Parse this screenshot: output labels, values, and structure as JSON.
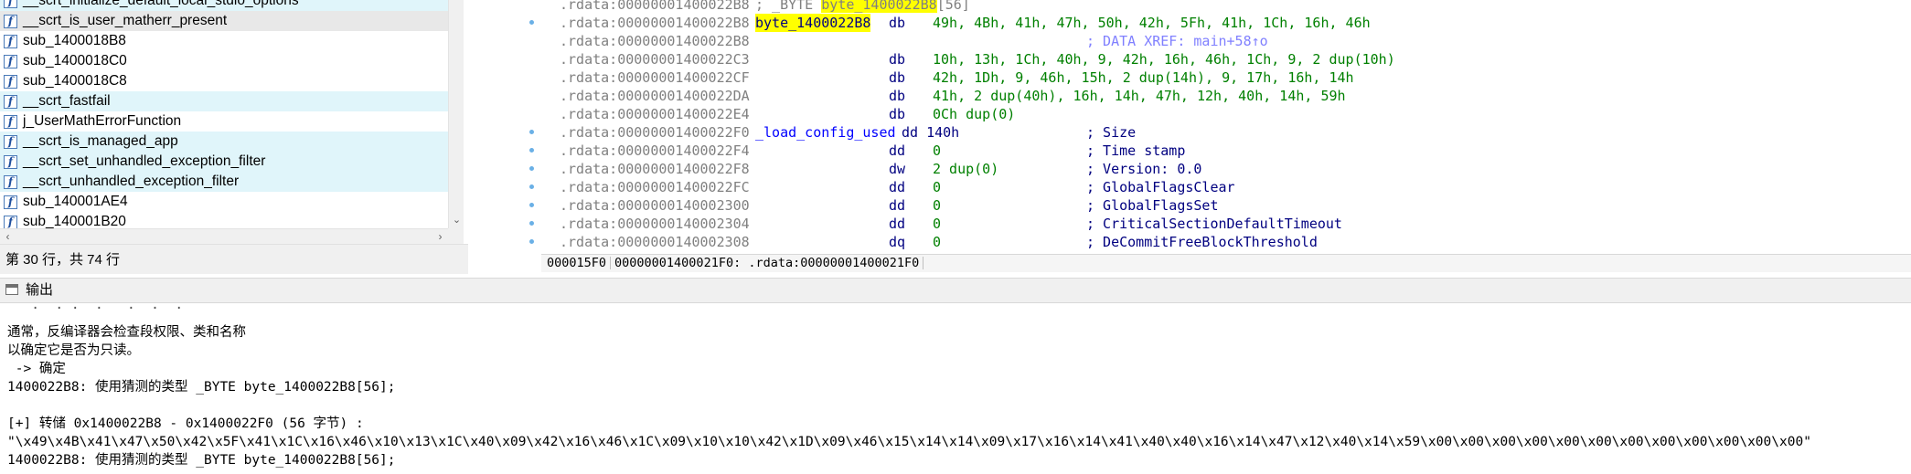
{
  "functions": {
    "items": [
      {
        "name": "__scrt_initialize_default_local_stdio_options",
        "style": "hl"
      },
      {
        "name": "__scrt_is_user_matherr_present",
        "style": "sel"
      },
      {
        "name": "sub_1400018B8",
        "style": ""
      },
      {
        "name": "sub_1400018C0",
        "style": ""
      },
      {
        "name": "sub_1400018C8",
        "style": ""
      },
      {
        "name": "__scrt_fastfail",
        "style": "hl"
      },
      {
        "name": "j_UserMathErrorFunction",
        "style": ""
      },
      {
        "name": "__scrt_is_managed_app",
        "style": "hl"
      },
      {
        "name": "__scrt_set_unhandled_exception_filter",
        "style": "hl"
      },
      {
        "name": "__scrt_unhandled_exception_filter",
        "style": "hl"
      },
      {
        "name": "sub_140001AE4",
        "style": ""
      },
      {
        "name": "sub_140001B20",
        "style": ""
      }
    ],
    "icon_glyph": "f",
    "status": "第 30 行，共 74 行"
  },
  "disasm": {
    "lines": [
      {
        "addr": ".rdata:00000001400022B8",
        "first_comment": "; _BYTE ",
        "first_comment_hl": "byte_1400022B8",
        "first_comment_tail": "[56]",
        "dot": false
      },
      {
        "addr": ".rdata:00000001400022B8",
        "label": "byte_1400022B8",
        "label_hl": true,
        "mnem": "db",
        "ops": "49h, 4Bh, 41h, 47h, 50h, 42h, 5Fh, 41h, 1Ch, 16h, 46h",
        "dot": true
      },
      {
        "addr": ".rdata:00000001400022B8",
        "xref": "; DATA XREF: main+58↑o",
        "dot": false
      },
      {
        "addr": ".rdata:00000001400022C3",
        "mnem": "db",
        "ops": "10h, 13h, 1Ch, 40h, 9, 42h, 16h, 46h, 1Ch, 9, 2 dup(10h)",
        "dot": false
      },
      {
        "addr": ".rdata:00000001400022CF",
        "mnem": "db",
        "ops": "42h, 1Dh, 9, 46h, 15h, 2 dup(14h), 9, 17h, 16h, 14h",
        "dot": false
      },
      {
        "addr": ".rdata:00000001400022DA",
        "mnem": "db",
        "ops": "41h, 2 dup(40h), 16h, 14h, 47h, 12h, 40h, 14h, 59h",
        "dot": false
      },
      {
        "addr": ".rdata:00000001400022E4",
        "mnem": "db",
        "ops": "0Ch dup(0)",
        "dot": false
      },
      {
        "addr": ".rdata:00000001400022F0",
        "label": "_load_config_used",
        "mnem_inline": "dd 140h",
        "comment": "; Size",
        "dot": true
      },
      {
        "addr": ".rdata:00000001400022F4",
        "mnem": "dd",
        "ops": "0",
        "comment": "; Time stamp",
        "dot": true
      },
      {
        "addr": ".rdata:00000001400022F8",
        "mnem": "dw",
        "ops": "2 dup(0)",
        "comment": "; Version: 0.0",
        "dot": true
      },
      {
        "addr": ".rdata:00000001400022FC",
        "mnem": "dd",
        "ops": "0",
        "comment": "; GlobalFlagsClear",
        "dot": true
      },
      {
        "addr": ".rdata:0000000140002300",
        "mnem": "dd",
        "ops": "0",
        "comment": "; GlobalFlagsSet",
        "dot": true
      },
      {
        "addr": ".rdata:0000000140002304",
        "mnem": "dd",
        "ops": "0",
        "comment": "; CriticalSectionDefaultTimeout",
        "dot": true
      },
      {
        "addr": ".rdata:0000000140002308",
        "mnem": "dq",
        "ops": "0",
        "comment": "; DeCommitFreeBlockThreshold",
        "dot": true
      }
    ],
    "status_offset": "000015F0",
    "status_location": "00000001400021F0: .rdata:00000001400021F0"
  },
  "output": {
    "title": "输出",
    "lines": [
      "通常，反编译器会检查段权限、类和名称",
      "以确定它是否为只读。",
      " -> 确定",
      "1400022B8: 使用猜测的类型 _BYTE byte_1400022B8[56];",
      "",
      "[+] 转储 0x1400022B8 - 0x1400022F0 (56 字节) :",
      "\"\\x49\\x4B\\x41\\x47\\x50\\x42\\x5F\\x41\\x1C\\x16\\x46\\x10\\x13\\x1C\\x40\\x09\\x42\\x16\\x46\\x1C\\x09\\x10\\x10\\x42\\x1D\\x09\\x46\\x15\\x14\\x14\\x09\\x17\\x16\\x14\\x41\\x40\\x40\\x16\\x14\\x47\\x12\\x40\\x14\\x59\\x00\\x00\\x00\\x00\\x00\\x00\\x00\\x00\\x00\\x00\\x00\\x00\"",
      "1400022B8: 使用猜测的类型 _BYTE byte_1400022B8[56];"
    ]
  }
}
